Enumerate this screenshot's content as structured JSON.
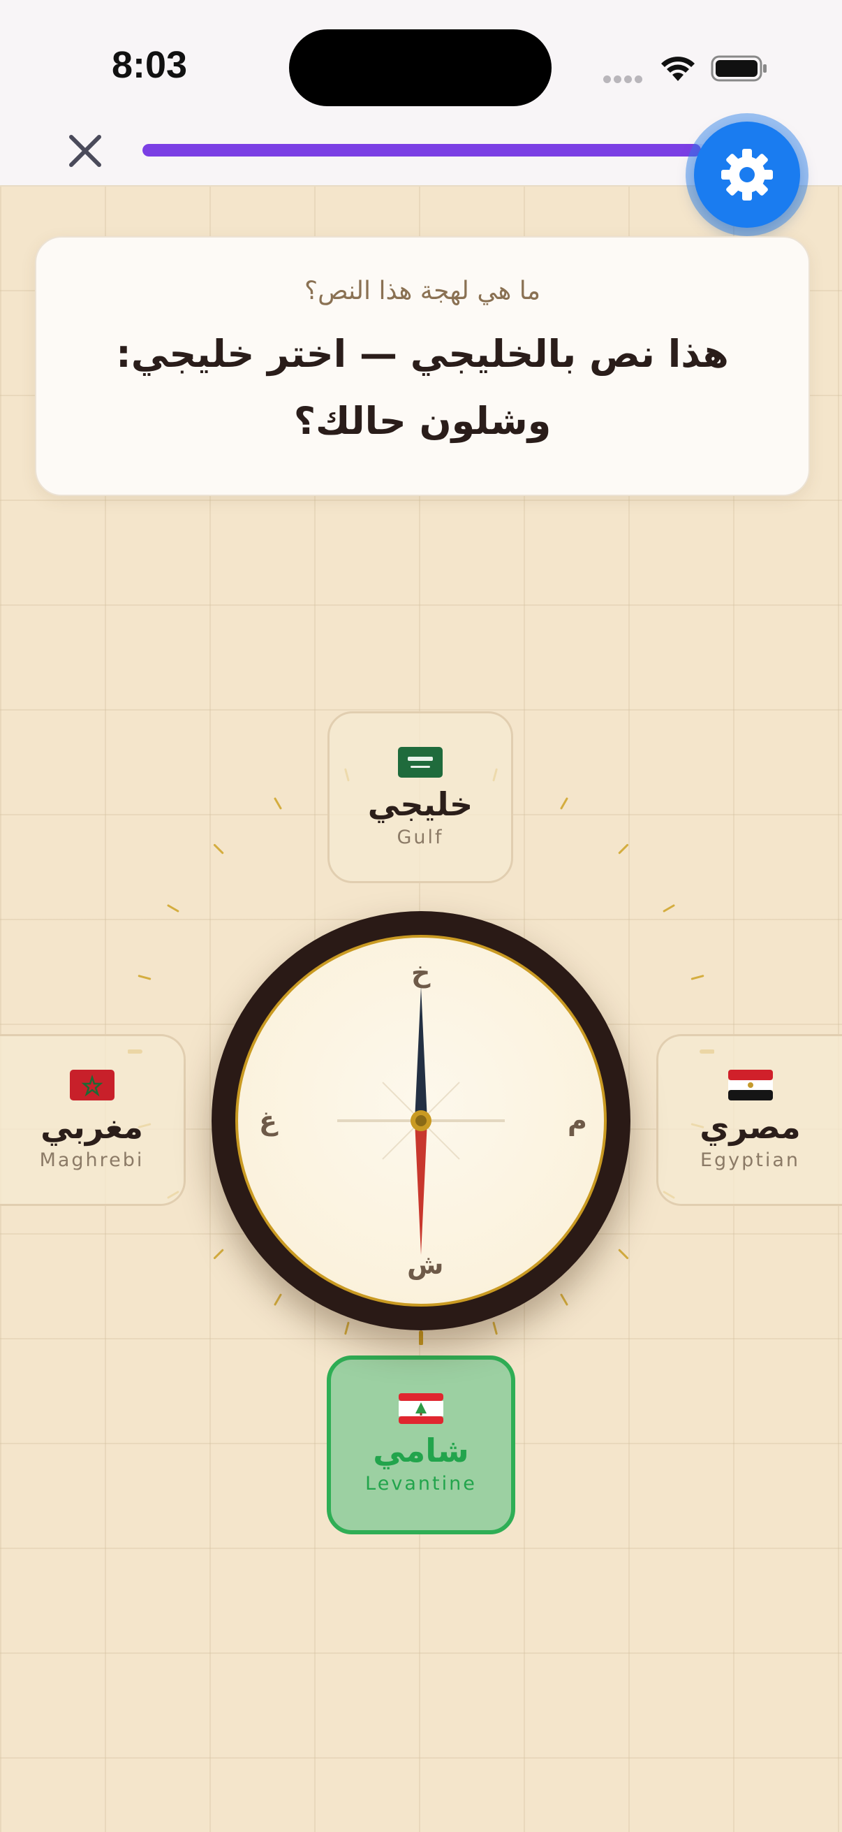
{
  "status_bar": {
    "time": "8:03"
  },
  "header": {
    "close_icon": "close-icon",
    "progress_fraction": 0.99,
    "settings_icon": "gear-icon",
    "accent_color": "#7b3fe4",
    "settings_color": "#1a7cf0"
  },
  "question": {
    "prompt": "ما هي لهجة هذا النص؟",
    "text_line1": "هذا نص بالخليجي — اختر خليجي:",
    "text_line2": "وشلون حالك؟"
  },
  "compass": {
    "north": "خ",
    "south": "ش",
    "west": "غ",
    "east": "م"
  },
  "options": {
    "gulf": {
      "name": "خليجي",
      "latin": "Gulf",
      "flag": "saudi-flag"
    },
    "maghrebi": {
      "name": "مغربي",
      "latin": "Maghrebi",
      "flag": "morocco-flag"
    },
    "egyptian": {
      "name": "مصري",
      "latin": "Egyptian",
      "flag": "egypt-flag"
    },
    "levantine": {
      "name": "شامي",
      "latin": "Levantine",
      "flag": "lebanon-flag",
      "selected": true,
      "selected_color": "#2fae55"
    }
  }
}
